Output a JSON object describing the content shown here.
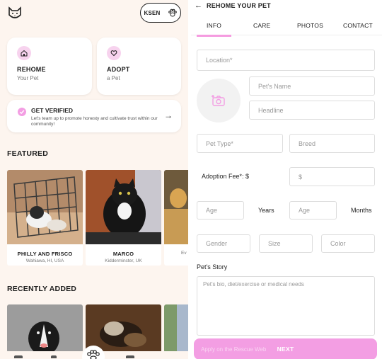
{
  "left": {
    "user_chip": {
      "label": "KSEN"
    },
    "cards": {
      "rehome": {
        "title": "REHOME",
        "sub": "Your Pet"
      },
      "adopt": {
        "title": "ADOPT",
        "sub": "a Pet"
      }
    },
    "verify": {
      "title": "GET VERIFIED",
      "text": "Let's team up to promote honesty and cultivate trust within our community!",
      "arrow": "→"
    },
    "featured_title": "FEATURED",
    "featured": [
      {
        "name": "PHILLY AND FRISCO",
        "location": "Wahiawa, HI, USA"
      },
      {
        "name": "MARCO",
        "location": "Kidderminster, UK"
      },
      {
        "name": "",
        "location": "Ev"
      }
    ],
    "recent_title": "RECENTLY ADDED"
  },
  "right": {
    "back_arrow": "←",
    "title": "REHOME YOUR PET",
    "tabs": [
      "INFO",
      "CARE",
      "PHOTOS",
      "CONTACT"
    ],
    "fields": {
      "location": "Location*",
      "pet_name": "Pet's Name",
      "headline": "Headline",
      "pet_type": "Pet Type*",
      "breed": "Breed",
      "adoption_fee_label": "Adoption Fee*: $",
      "fee_placeholder": "$",
      "age_years": "Age",
      "years_label": "Years",
      "age_months": "Age",
      "months_label": "Months",
      "gender": "Gender",
      "size": "Size",
      "color": "Color",
      "story_label": "Pet's Story",
      "story_placeholder": "Pet's bio, diet/exercise or medical needs"
    },
    "ghost_text": "Apply on the Rescue Web",
    "next_label": "NEXT"
  },
  "colors": {
    "accent": "#f39ee3",
    "background": "#fdf5ef"
  }
}
